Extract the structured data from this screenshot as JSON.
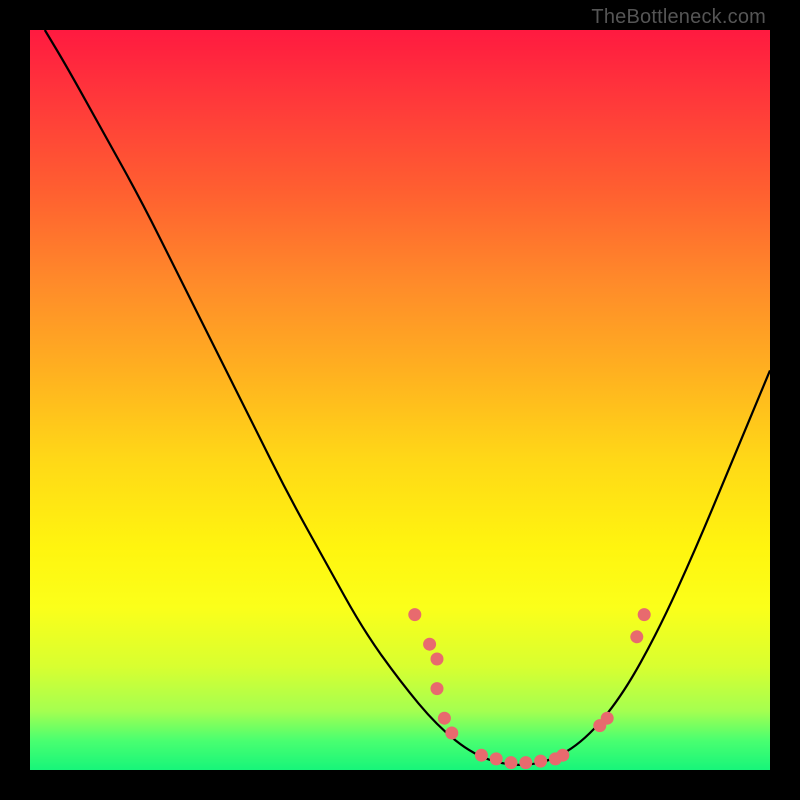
{
  "watermark": "TheBottleneck.com",
  "chart_data": {
    "type": "line",
    "title": "",
    "xlabel": "",
    "ylabel": "",
    "xlim": [
      0,
      100
    ],
    "ylim": [
      0,
      100
    ],
    "curve": [
      {
        "x": 2,
        "y": 100
      },
      {
        "x": 5,
        "y": 95
      },
      {
        "x": 10,
        "y": 86
      },
      {
        "x": 15,
        "y": 77
      },
      {
        "x": 20,
        "y": 67
      },
      {
        "x": 25,
        "y": 57
      },
      {
        "x": 30,
        "y": 47
      },
      {
        "x": 35,
        "y": 37
      },
      {
        "x": 40,
        "y": 28
      },
      {
        "x": 45,
        "y": 19
      },
      {
        "x": 50,
        "y": 12
      },
      {
        "x": 55,
        "y": 6
      },
      {
        "x": 60,
        "y": 2
      },
      {
        "x": 65,
        "y": 0.5
      },
      {
        "x": 70,
        "y": 1
      },
      {
        "x": 75,
        "y": 4
      },
      {
        "x": 80,
        "y": 10
      },
      {
        "x": 85,
        "y": 19
      },
      {
        "x": 90,
        "y": 30
      },
      {
        "x": 95,
        "y": 42
      },
      {
        "x": 100,
        "y": 54
      }
    ],
    "points": [
      {
        "x": 52,
        "y": 21
      },
      {
        "x": 54,
        "y": 17
      },
      {
        "x": 55,
        "y": 15
      },
      {
        "x": 55,
        "y": 11
      },
      {
        "x": 56,
        "y": 7
      },
      {
        "x": 57,
        "y": 5
      },
      {
        "x": 61,
        "y": 2
      },
      {
        "x": 63,
        "y": 1.5
      },
      {
        "x": 65,
        "y": 1
      },
      {
        "x": 67,
        "y": 1
      },
      {
        "x": 69,
        "y": 1.2
      },
      {
        "x": 71,
        "y": 1.5
      },
      {
        "x": 72,
        "y": 2
      },
      {
        "x": 77,
        "y": 6
      },
      {
        "x": 78,
        "y": 7
      },
      {
        "x": 82,
        "y": 18
      },
      {
        "x": 83,
        "y": 21
      }
    ],
    "point_color": "#e86a6e",
    "curve_color": "#000000"
  }
}
